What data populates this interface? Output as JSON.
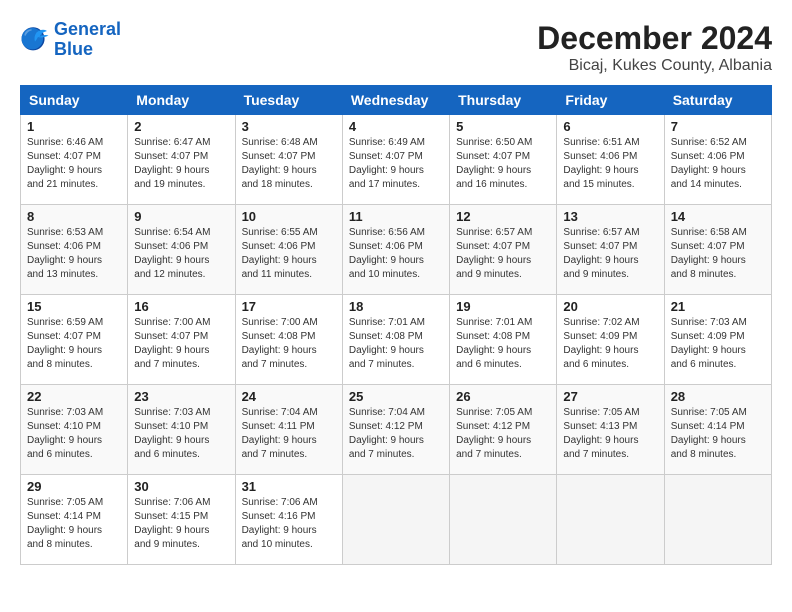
{
  "logo": {
    "line1": "General",
    "line2": "Blue"
  },
  "title": "December 2024",
  "subtitle": "Bicaj, Kukes County, Albania",
  "weekdays": [
    "Sunday",
    "Monday",
    "Tuesday",
    "Wednesday",
    "Thursday",
    "Friday",
    "Saturday"
  ],
  "weeks": [
    [
      {
        "day": "1",
        "sunrise": "6:46 AM",
        "sunset": "4:07 PM",
        "daylight": "9 hours and 21 minutes."
      },
      {
        "day": "2",
        "sunrise": "6:47 AM",
        "sunset": "4:07 PM",
        "daylight": "9 hours and 19 minutes."
      },
      {
        "day": "3",
        "sunrise": "6:48 AM",
        "sunset": "4:07 PM",
        "daylight": "9 hours and 18 minutes."
      },
      {
        "day": "4",
        "sunrise": "6:49 AM",
        "sunset": "4:07 PM",
        "daylight": "9 hours and 17 minutes."
      },
      {
        "day": "5",
        "sunrise": "6:50 AM",
        "sunset": "4:07 PM",
        "daylight": "9 hours and 16 minutes."
      },
      {
        "day": "6",
        "sunrise": "6:51 AM",
        "sunset": "4:06 PM",
        "daylight": "9 hours and 15 minutes."
      },
      {
        "day": "7",
        "sunrise": "6:52 AM",
        "sunset": "4:06 PM",
        "daylight": "9 hours and 14 minutes."
      }
    ],
    [
      {
        "day": "8",
        "sunrise": "6:53 AM",
        "sunset": "4:06 PM",
        "daylight": "9 hours and 13 minutes."
      },
      {
        "day": "9",
        "sunrise": "6:54 AM",
        "sunset": "4:06 PM",
        "daylight": "9 hours and 12 minutes."
      },
      {
        "day": "10",
        "sunrise": "6:55 AM",
        "sunset": "4:06 PM",
        "daylight": "9 hours and 11 minutes."
      },
      {
        "day": "11",
        "sunrise": "6:56 AM",
        "sunset": "4:06 PM",
        "daylight": "9 hours and 10 minutes."
      },
      {
        "day": "12",
        "sunrise": "6:57 AM",
        "sunset": "4:07 PM",
        "daylight": "9 hours and 9 minutes."
      },
      {
        "day": "13",
        "sunrise": "6:57 AM",
        "sunset": "4:07 PM",
        "daylight": "9 hours and 9 minutes."
      },
      {
        "day": "14",
        "sunrise": "6:58 AM",
        "sunset": "4:07 PM",
        "daylight": "9 hours and 8 minutes."
      }
    ],
    [
      {
        "day": "15",
        "sunrise": "6:59 AM",
        "sunset": "4:07 PM",
        "daylight": "9 hours and 8 minutes."
      },
      {
        "day": "16",
        "sunrise": "7:00 AM",
        "sunset": "4:07 PM",
        "daylight": "9 hours and 7 minutes."
      },
      {
        "day": "17",
        "sunrise": "7:00 AM",
        "sunset": "4:08 PM",
        "daylight": "9 hours and 7 minutes."
      },
      {
        "day": "18",
        "sunrise": "7:01 AM",
        "sunset": "4:08 PM",
        "daylight": "9 hours and 7 minutes."
      },
      {
        "day": "19",
        "sunrise": "7:01 AM",
        "sunset": "4:08 PM",
        "daylight": "9 hours and 6 minutes."
      },
      {
        "day": "20",
        "sunrise": "7:02 AM",
        "sunset": "4:09 PM",
        "daylight": "9 hours and 6 minutes."
      },
      {
        "day": "21",
        "sunrise": "7:03 AM",
        "sunset": "4:09 PM",
        "daylight": "9 hours and 6 minutes."
      }
    ],
    [
      {
        "day": "22",
        "sunrise": "7:03 AM",
        "sunset": "4:10 PM",
        "daylight": "9 hours and 6 minutes."
      },
      {
        "day": "23",
        "sunrise": "7:03 AM",
        "sunset": "4:10 PM",
        "daylight": "9 hours and 6 minutes."
      },
      {
        "day": "24",
        "sunrise": "7:04 AM",
        "sunset": "4:11 PM",
        "daylight": "9 hours and 7 minutes."
      },
      {
        "day": "25",
        "sunrise": "7:04 AM",
        "sunset": "4:12 PM",
        "daylight": "9 hours and 7 minutes."
      },
      {
        "day": "26",
        "sunrise": "7:05 AM",
        "sunset": "4:12 PM",
        "daylight": "9 hours and 7 minutes."
      },
      {
        "day": "27",
        "sunrise": "7:05 AM",
        "sunset": "4:13 PM",
        "daylight": "9 hours and 7 minutes."
      },
      {
        "day": "28",
        "sunrise": "7:05 AM",
        "sunset": "4:14 PM",
        "daylight": "9 hours and 8 minutes."
      }
    ],
    [
      {
        "day": "29",
        "sunrise": "7:05 AM",
        "sunset": "4:14 PM",
        "daylight": "9 hours and 8 minutes."
      },
      {
        "day": "30",
        "sunrise": "7:06 AM",
        "sunset": "4:15 PM",
        "daylight": "9 hours and 9 minutes."
      },
      {
        "day": "31",
        "sunrise": "7:06 AM",
        "sunset": "4:16 PM",
        "daylight": "9 hours and 10 minutes."
      },
      null,
      null,
      null,
      null
    ]
  ],
  "labels": {
    "sunrise": "Sunrise:",
    "sunset": "Sunset:",
    "daylight": "Daylight hours"
  }
}
